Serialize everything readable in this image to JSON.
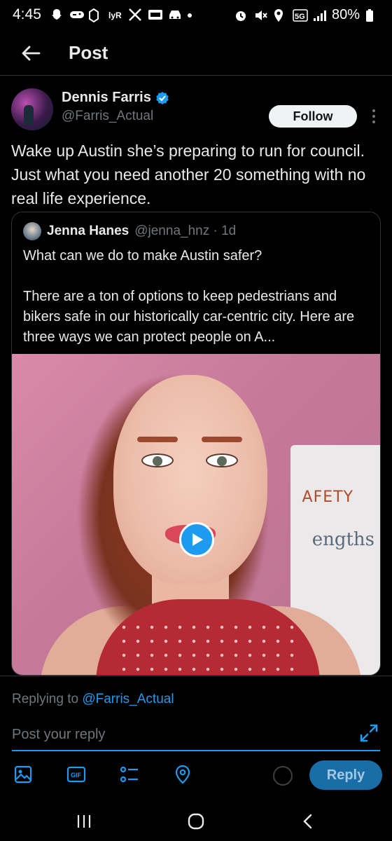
{
  "status_bar": {
    "time": "4:45",
    "network": "5G",
    "battery": "80%"
  },
  "header": {
    "title": "Post"
  },
  "post": {
    "author": {
      "display_name": "Dennis Farris",
      "handle": "@Farris_Actual",
      "verified": true
    },
    "follow_label": "Follow",
    "text": "Wake up Austin she’s preparing to run for council. Just what you need another 20 something with no real life experience.",
    "quote": {
      "display_name": "Jenna Hanes",
      "meta": "@jenna_hnz · 1d",
      "text": "What can we do to make Austin safer?\n\nThere are a ton of options to keep pedestrians and bikers safe in our historically car-centric city. Here are three ways we can protect people on A...",
      "media": {
        "type": "video",
        "whiteboard_text_1": "AFETY",
        "whiteboard_text_2": "engths"
      }
    }
  },
  "composer": {
    "replying_prefix": "Replying to ",
    "replying_to": "@Farris_Actual",
    "placeholder": "Post your reply",
    "reply_label": "Reply",
    "tools": [
      "image-icon",
      "gif-icon",
      "poll-icon",
      "location-icon"
    ],
    "gif_label": "GIF"
  },
  "colors": {
    "accent": "#1d9bf0",
    "background": "#000000",
    "text_primary": "#e7e9ea",
    "text_secondary": "#71767b",
    "border": "#2f3336"
  }
}
